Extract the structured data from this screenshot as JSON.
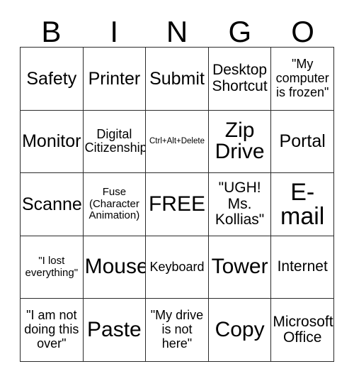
{
  "card": {
    "title": "BINGO",
    "headers": [
      "B",
      "I",
      "N",
      "G",
      "O"
    ],
    "free_space_label": "FREE",
    "colors": {
      "grid_line": "#2b2b2b",
      "text": "#000000",
      "background": "#ffffff"
    },
    "cells": [
      {
        "text": "Safety",
        "size": "xl"
      },
      {
        "text": "Printer",
        "size": "xl"
      },
      {
        "text": "Submit",
        "size": "xl"
      },
      {
        "text": "Desktop\nShortcut",
        "size": "lg"
      },
      {
        "text": "\"My\ncomputer\nis frozen\"",
        "size": "md"
      },
      {
        "text": "Monitor",
        "size": "xl"
      },
      {
        "text": "Digital\nCitizenship",
        "size": "md"
      },
      {
        "text": "Ctrl+Alt+Delete",
        "size": "xs"
      },
      {
        "text": "Zip\nDrive",
        "size": "2xl"
      },
      {
        "text": "Portal",
        "size": "xl"
      },
      {
        "text": "Scanner",
        "size": "xl"
      },
      {
        "text": "Fuse\n(Character\nAnimation)",
        "size": "sm"
      },
      {
        "text": "FREE",
        "size": "2xl"
      },
      {
        "text": "\"UGH!\nMs.\nKollias\"",
        "size": "lg"
      },
      {
        "text": "E-\nmail",
        "size": "3xl"
      },
      {
        "text": "\"I lost\neverything\"",
        "size": "sm"
      },
      {
        "text": "Mouse",
        "size": "2xl"
      },
      {
        "text": "Keyboard",
        "size": "md"
      },
      {
        "text": "Tower",
        "size": "2xl"
      },
      {
        "text": "Internet",
        "size": "lg"
      },
      {
        "text": "\"I am not\ndoing this\nover\"",
        "size": "md"
      },
      {
        "text": "Paste",
        "size": "2xl"
      },
      {
        "text": "\"My drive\nis not\nhere\"",
        "size": "md"
      },
      {
        "text": "Copy",
        "size": "2xl"
      },
      {
        "text": "Microsoft\nOffice",
        "size": "lg"
      }
    ]
  }
}
